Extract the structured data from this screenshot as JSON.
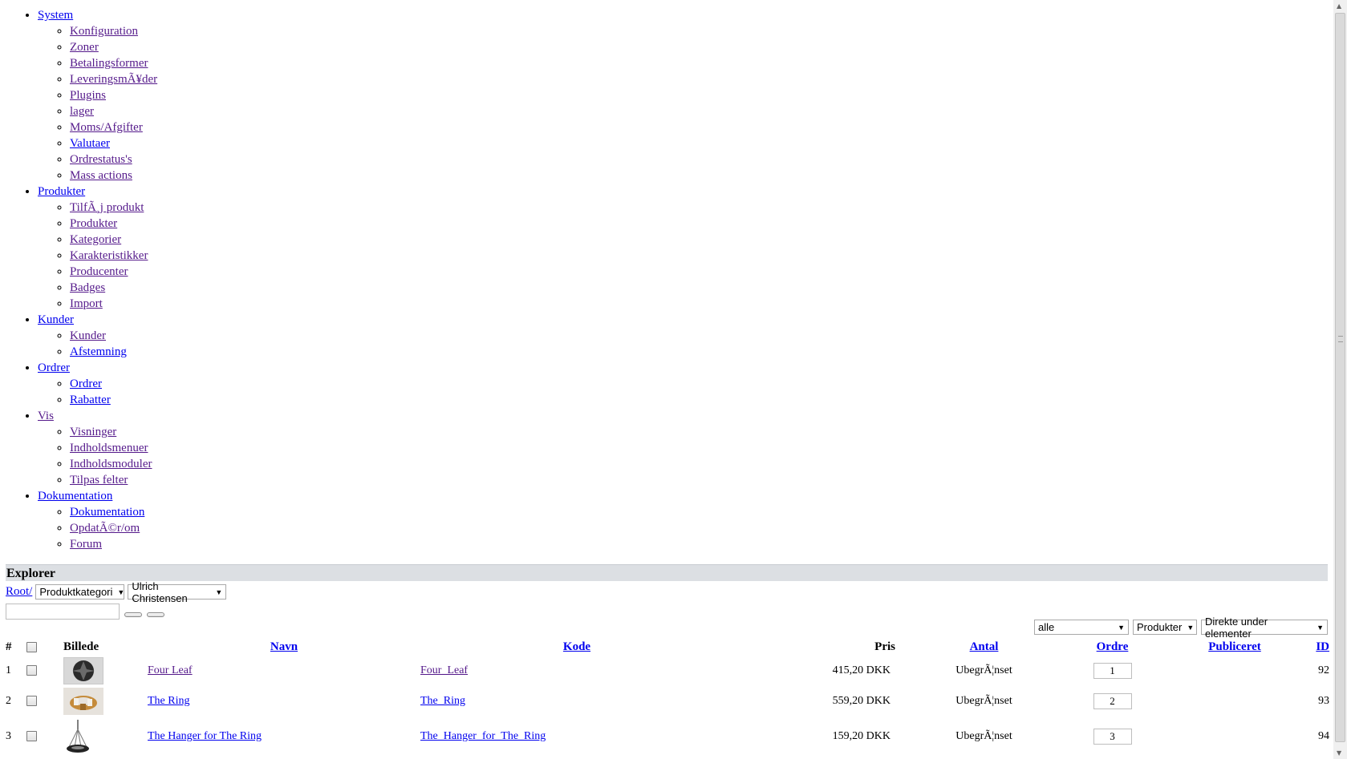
{
  "nav": [
    {
      "label": "System",
      "items": [
        "Konfiguration",
        "Zoner",
        "Betalingsformer",
        "LeveringsmÃ¥der",
        "Plugins",
        "lager",
        "Moms/Afgifter",
        "Valutaer",
        "Ordrestatus's",
        "Mass actions"
      ]
    },
    {
      "label": "Produkter",
      "items": [
        "TilfÃ¸j produkt",
        "Produkter",
        "Kategorier",
        "Karakteristikker",
        "Producenter",
        "Badges",
        "Import"
      ]
    },
    {
      "label": "Kunder",
      "items": [
        "Kunder",
        "Afstemning"
      ]
    },
    {
      "label": "Ordrer",
      "items": [
        "Ordrer",
        "Rabatter"
      ]
    },
    {
      "label": "Vis",
      "items": [
        "Visninger",
        "Indholdsmenuer",
        "Indholdsmoduler",
        "Tilpas felter"
      ]
    },
    {
      "label": "Dokumentation",
      "items": [
        "Dokumentation",
        "OpdatÃ©r/om",
        "Forum"
      ]
    }
  ],
  "explorer": {
    "title": "Explorer",
    "root_link": "Root/",
    "category_select": "Produktkategori",
    "user_select": "Ulrich Christensen",
    "search_value": "",
    "filter_all": "alle",
    "filter_type": "Produkter",
    "filter_scope": "Direkte under elementer"
  },
  "table": {
    "headers": {
      "num": "#",
      "image": "Billede",
      "name": "Navn",
      "code": "Kode",
      "price": "Pris",
      "qty": "Antal",
      "order": "Ordre",
      "published": "Publiceret",
      "id": "ID"
    },
    "rows": [
      {
        "num": "1",
        "name": "Four Leaf",
        "code": "Four_Leaf",
        "price": "415,20 DKK",
        "qty": "UbegrÃ¦nset",
        "order": "1",
        "id": "92",
        "image_icon": "four-leaf-product-thumbnail-icon"
      },
      {
        "num": "2",
        "name": "The Ring",
        "code": "The_Ring",
        "price": "559,20 DKK",
        "qty": "UbegrÃ¦nset",
        "order": "2",
        "id": "93",
        "image_icon": "ring-product-thumbnail-icon"
      },
      {
        "num": "3",
        "name": "The Hanger for The Ring",
        "code": "The_Hanger_for_The_Ring",
        "price": "159,20 DKK",
        "qty": "UbegrÃ¦nset",
        "order": "3",
        "id": "94",
        "image_icon": "hanger-product-thumbnail-icon"
      }
    ]
  },
  "colors": {
    "link": "#0000ee",
    "visited": "#551a8b",
    "explorer_bar": "#dcdfe3"
  }
}
